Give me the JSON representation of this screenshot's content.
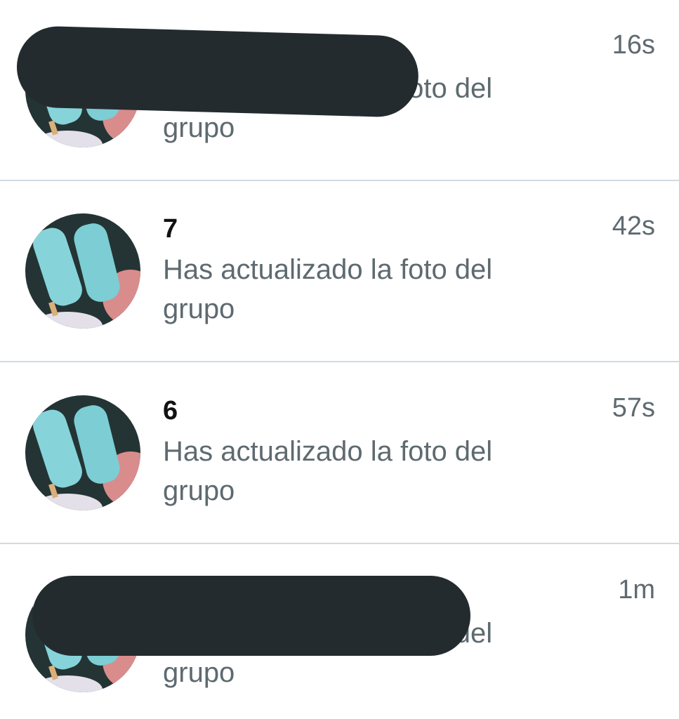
{
  "chats": [
    {
      "title": "",
      "message": "Has actualizado la foto del grupo",
      "time": "16s",
      "avatar": "popsicle-group-photo",
      "redacted": true
    },
    {
      "title": "7",
      "message": "Has actualizado la foto del grupo",
      "time": "42s",
      "avatar": "popsicle-group-photo",
      "redacted": false
    },
    {
      "title": "6",
      "message": "Has actualizado la foto del grupo",
      "time": "57s",
      "avatar": "popsicle-group-photo",
      "redacted": false
    },
    {
      "title": "",
      "message": "Has actualizado la foto del grupo",
      "time": "1m",
      "avatar": "popsicle-group-photo",
      "redacted": true
    }
  ],
  "colors": {
    "title": "#111111",
    "message": "#5e6a70",
    "divider": "#cfdbe2",
    "redaction": "#242b2f",
    "popsicle": "#7fd0d6"
  }
}
